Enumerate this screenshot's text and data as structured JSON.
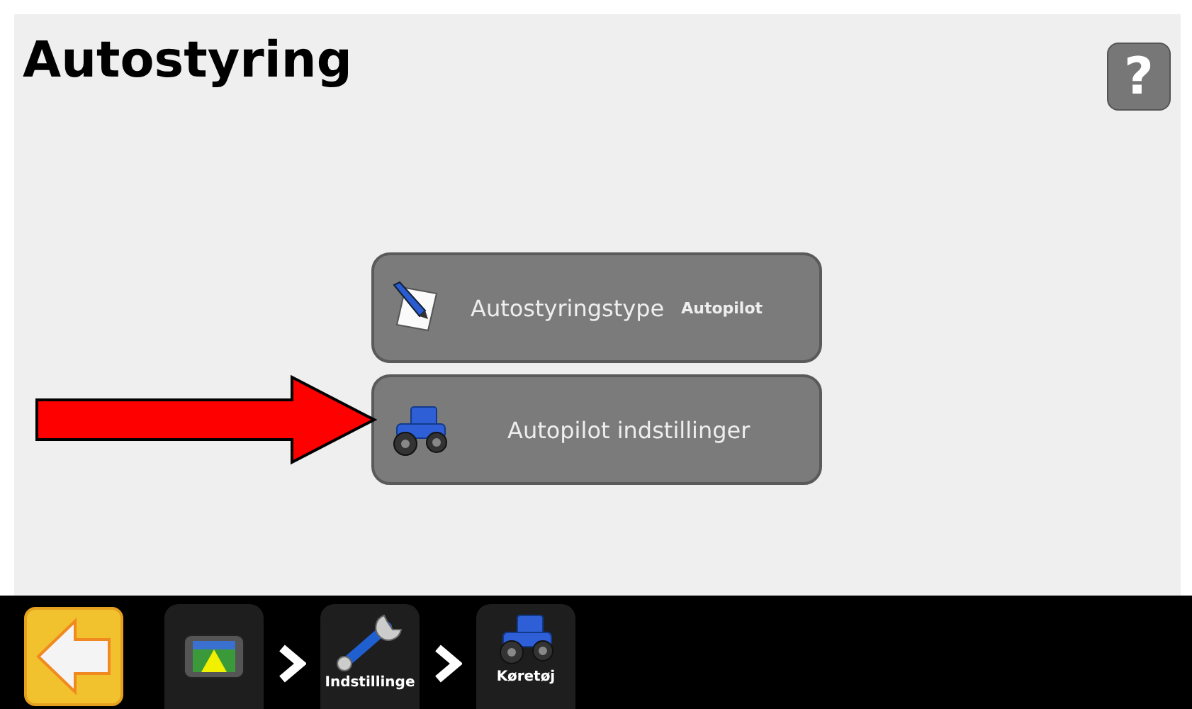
{
  "title": "Autostyring",
  "help_button": "?",
  "menu_items": [
    {
      "kind": "notepad",
      "label": "Autostyringstype",
      "value": "Autopilot"
    },
    {
      "kind": "tractor",
      "label": "Autopilot indstillinger"
    }
  ],
  "breadcrumbs": [
    {
      "kind": "display"
    },
    {
      "kind": "wrench",
      "label": "Indstillinge"
    },
    {
      "kind": "tractor",
      "label": "Køretøj"
    }
  ]
}
